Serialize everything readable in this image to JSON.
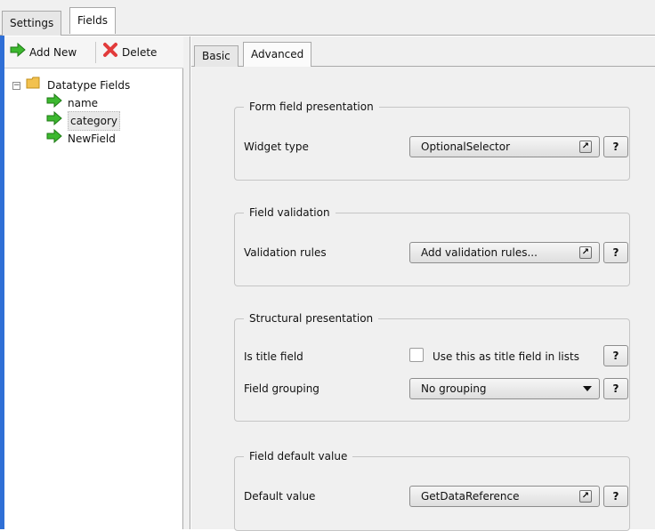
{
  "top_tabs": [
    {
      "label": "Settings"
    },
    {
      "label": "Fields"
    }
  ],
  "toolbar": {
    "add_new_label": "Add New",
    "delete_label": "Delete"
  },
  "tree": {
    "root_label": "Datatype Fields",
    "expander": "⊟",
    "items": [
      {
        "label": "name"
      },
      {
        "label": "category"
      },
      {
        "label": "NewField"
      }
    ]
  },
  "right_tabs": [
    {
      "label": "Basic"
    },
    {
      "label": "Advanced"
    }
  ],
  "groups": {
    "form": {
      "title": "Form field presentation",
      "widget_type_label": "Widget type",
      "widget_type_value": "OptionalSelector",
      "help": "?"
    },
    "validation": {
      "title": "Field validation",
      "rules_label": "Validation rules",
      "rules_value": "Add validation rules...",
      "help": "?"
    },
    "structural": {
      "title": "Structural presentation",
      "is_title_label": "Is title field",
      "checkbox_label": "Use this as title field in lists",
      "grouping_label": "Field grouping",
      "grouping_value": "No grouping",
      "help1": "?",
      "help2": "?"
    },
    "default": {
      "title": "Field default value",
      "default_label": "Default value",
      "default_value": "GetDataReference",
      "help": "?"
    }
  },
  "colors": {
    "accent_blue": "#2f6fd6",
    "add_icon_green": "#3cb82f",
    "delete_icon_red": "#e23b3b",
    "folder_yellow": "#f2c14e"
  }
}
